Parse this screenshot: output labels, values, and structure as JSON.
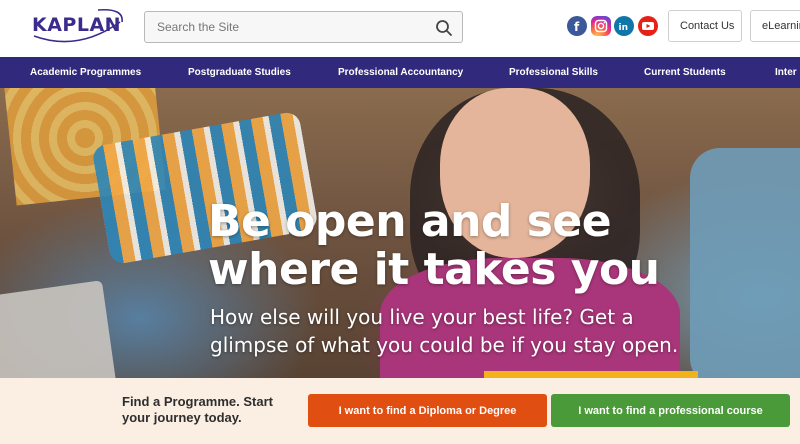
{
  "header": {
    "logo_text": "KAPLAN",
    "search_placeholder": "Search the Site",
    "social": [
      "facebook-icon",
      "instagram-icon",
      "linkedin-icon",
      "youtube-icon"
    ],
    "contact_label": "Contact Us",
    "elearning_label": "eLearnin"
  },
  "nav": {
    "items": [
      {
        "label": "Academic Programmes"
      },
      {
        "label": "Postgraduate Studies"
      },
      {
        "label": "Professional Accountancy"
      },
      {
        "label": "Professional Skills"
      },
      {
        "label": "Current Students"
      },
      {
        "label": "Inter"
      }
    ]
  },
  "hero": {
    "title_line1": "Be open and see",
    "title_line2": "where it takes you",
    "subtitle_line1": "How else will you live your best life? Get a",
    "subtitle_line2": "glimpse of what you could be if you stay open."
  },
  "findbar": {
    "text_line1": "Find a Programme. Start",
    "text_line2": "your journey today.",
    "diploma_button": "I want to find a Diploma or Degree",
    "course_button": "I want to find a professional course"
  },
  "colors": {
    "brand_purple": "#312a7c",
    "logo_purple": "#3a2b8c",
    "cta_orange": "#e04e12",
    "cta_green": "#4a9a3a",
    "findbar_bg": "#fbeee2",
    "accent_yellow": "#f3b21b"
  }
}
